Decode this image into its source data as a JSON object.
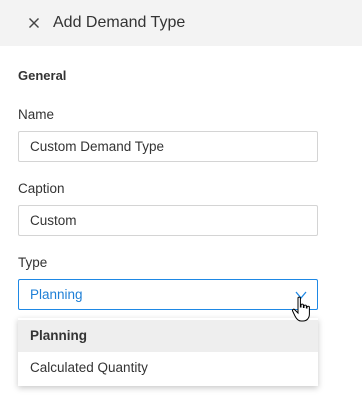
{
  "header": {
    "title": "Add Demand Type",
    "close_icon": "close-icon"
  },
  "form": {
    "section_title": "General",
    "name": {
      "label": "Name",
      "value": "Custom Demand Type"
    },
    "caption": {
      "label": "Caption",
      "value": "Custom"
    },
    "type": {
      "label": "Type",
      "selected": "Planning",
      "icon": "chevron-down-icon",
      "options": [
        "Planning",
        "Calculated Quantity"
      ]
    }
  },
  "colors": {
    "accent": "#1e88e5",
    "header_bg": "#f3f3f3",
    "selected_option_bg": "#eeeeee"
  }
}
